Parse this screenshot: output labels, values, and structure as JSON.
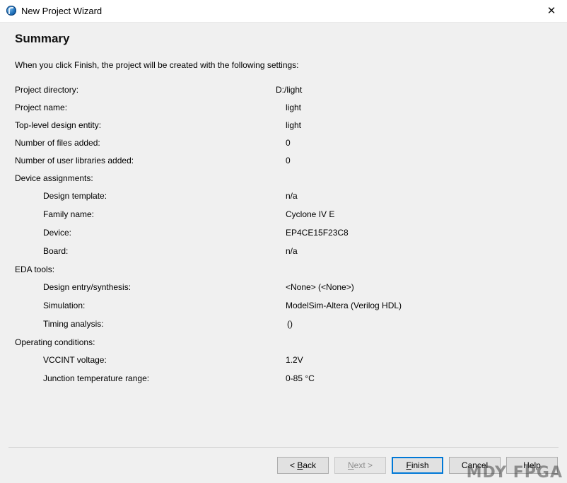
{
  "window": {
    "title": "New Project Wizard",
    "close_glyph": "✕"
  },
  "page": {
    "heading": "Summary",
    "intro": "When you click Finish, the project will be created with the following settings:"
  },
  "settings": {
    "project_directory": {
      "label": "Project directory:",
      "value": "D:/light"
    },
    "project_name": {
      "label": "Project name:",
      "value": "light"
    },
    "top_level_entity": {
      "label": "Top-level design entity:",
      "value": "light"
    },
    "files_added": {
      "label": "Number of files added:",
      "value": "0"
    },
    "user_libraries_added": {
      "label": "Number of user libraries added:",
      "value": "0"
    },
    "device_assignments": {
      "label": "Device assignments:",
      "design_template": {
        "label": "Design template:",
        "value": "n/a"
      },
      "family_name": {
        "label": "Family name:",
        "value": "Cyclone IV E"
      },
      "device": {
        "label": "Device:",
        "value": "EP4CE15F23C8"
      },
      "board": {
        "label": "Board:",
        "value": "n/a"
      }
    },
    "eda_tools": {
      "label": "EDA tools:",
      "design_entry": {
        "label": "Design entry/synthesis:",
        "value": "<None> (<None>)"
      },
      "simulation": {
        "label": "Simulation:",
        "value": "ModelSim-Altera (Verilog HDL)"
      },
      "timing_analysis": {
        "label": "Timing analysis:",
        "value": "()"
      }
    },
    "operating_conditions": {
      "label": "Operating conditions:",
      "vccint_voltage": {
        "label": "VCCINT voltage:",
        "value": "1.2V"
      },
      "junction_temperature": {
        "label": "Junction temperature range:",
        "value": "0-85 °C"
      }
    }
  },
  "buttons": {
    "back": {
      "prefix": "< ",
      "mnemonic": "B",
      "rest": "ack"
    },
    "next": {
      "mnemonic": "N",
      "rest": "ext >"
    },
    "finish": {
      "mnemonic": "F",
      "rest": "inish"
    },
    "cancel": {
      "label": "Cancel"
    },
    "help": {
      "label": "Help"
    }
  },
  "watermark": "MDY FPGA",
  "colors": {
    "focus_border": "#0078d7",
    "background": "#f0f0f0"
  }
}
